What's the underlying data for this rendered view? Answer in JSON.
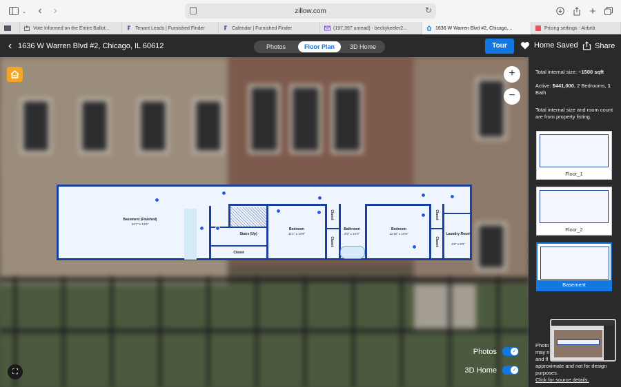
{
  "browser": {
    "url": "zillow.com",
    "tabs": [
      {
        "label": "Vote Informed on the Entire Ballot...",
        "icon": "ballot-icon"
      },
      {
        "label": "Tenant Leads | Furnished Finder",
        "icon": "ff-icon"
      },
      {
        "label": "Calendar | Furnished Finder",
        "icon": "ff-icon"
      },
      {
        "label": "(197,397 unread) - beckykeeler2...",
        "icon": "mail-icon"
      },
      {
        "label": "1636 W Warren Blvd #2, Chicago,...",
        "icon": "zillow-icon"
      },
      {
        "label": "Pricing settings - Airbnb",
        "icon": "airbnb-icon"
      }
    ]
  },
  "header": {
    "address": "1636 W Warren Blvd #2, Chicago, IL 60612",
    "segments": [
      "Photos",
      "Floor Plan",
      "3D Home"
    ],
    "active_segment": "Floor Plan",
    "tour_label": "Tour",
    "saved_label": "Home Saved",
    "share_label": "Share"
  },
  "viewer": {
    "toggles": [
      {
        "label": "Photos",
        "on": true
      },
      {
        "label": "3D Home",
        "on": true
      }
    ]
  },
  "floorplan": {
    "rooms": [
      {
        "name": "Basement (Finished)",
        "dims": "34'7\" x 13'6\""
      },
      {
        "name": "Stairs (Up)",
        "dims": ""
      },
      {
        "name": "Closet",
        "dims": ""
      },
      {
        "name": "Bedroom",
        "dims": "11'1\" x 10'9\""
      },
      {
        "name": "Closet",
        "dims": ""
      },
      {
        "name": "Closet",
        "dims": ""
      },
      {
        "name": "Bathroom",
        "dims": "4'9\" x 10'0\""
      },
      {
        "name": "Bedroom",
        "dims": "11'10\" x 10'9\""
      },
      {
        "name": "Closet",
        "dims": ""
      },
      {
        "name": "Closet",
        "dims": ""
      },
      {
        "name": "Laundry Room",
        "dims": "4'8\" x 8'0\""
      }
    ]
  },
  "panel": {
    "size_label": "Total internal size:",
    "size_value": "~1500 sqft",
    "active_prefix": "Active:",
    "active_price": "$441,000",
    "active_beds": "2",
    "active_beds_label": "Bedrooms,",
    "active_baths": "1",
    "active_baths_label": "Bath",
    "note": "Total internal size and room count are from property listing.",
    "floors": [
      {
        "label": "Floor_1",
        "active": false
      },
      {
        "label": "Floor_2",
        "active": false
      },
      {
        "label": "Basement",
        "active": true
      }
    ],
    "disclaimer_lines": [
      "Photo",
      "may n",
      "and fl",
      "approximate and not for design",
      "purposes."
    ],
    "disclaimer_link": "Click for source details."
  },
  "colors": {
    "accent": "#1277e1",
    "wall": "#1a3fa0",
    "dot": "#1e5ee8",
    "header_bg": "#2a2a2c"
  }
}
